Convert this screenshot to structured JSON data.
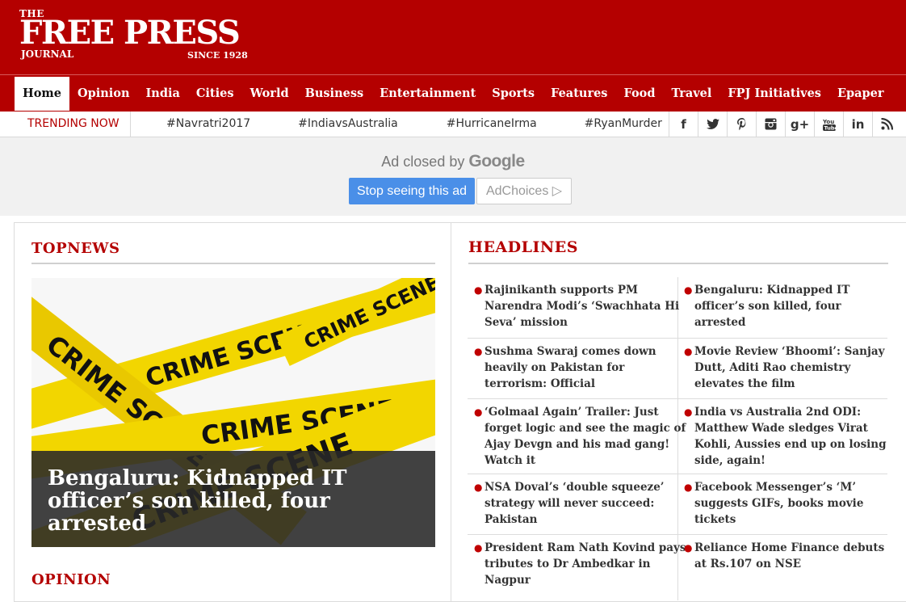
{
  "logo": {
    "the": "THE",
    "main": "FREE PRESS",
    "journal": "JOURNAL",
    "since": "SINCE 1928"
  },
  "nav": [
    "Home",
    "Opinion",
    "India",
    "Cities",
    "World",
    "Business",
    "Entertainment",
    "Sports",
    "Features",
    "Food",
    "Travel",
    "FPJ Initiatives",
    "Epaper"
  ],
  "trending": {
    "label": "TRENDING NOW",
    "tags": [
      "#Navratri2017",
      "#IndiavsAustralia",
      "#HurricaneIrma",
      "#RyanMurder"
    ]
  },
  "social_icons": [
    {
      "name": "facebook-icon",
      "glyph": "f"
    },
    {
      "name": "twitter-icon",
      "glyph": "🐦"
    },
    {
      "name": "pinterest-icon",
      "glyph": "P"
    },
    {
      "name": "instagram-icon",
      "glyph": "◙"
    },
    {
      "name": "googleplus-icon",
      "glyph": "g+"
    },
    {
      "name": "youtube-icon",
      "glyph": "▶"
    },
    {
      "name": "linkedin-icon",
      "glyph": "in"
    },
    {
      "name": "rss-icon",
      "glyph": "◉"
    }
  ],
  "ad": {
    "closed_prefix": "Ad closed by",
    "closed_brand": "Google",
    "stop_label": "Stop seeing this ad",
    "choices_label": "AdChoices ▷"
  },
  "topnews": {
    "heading": "TOPNEWS",
    "image_text": "CRIME SCENE",
    "caption": "Bengaluru: Kidnapped IT officer’s son killed, four arrested"
  },
  "opinion": {
    "heading": "OPINION"
  },
  "headlines": {
    "heading": "HEADLINES",
    "left": [
      "Rajinikanth supports PM Narendra Modi’s ‘Swachhata Hi Seva’ mission",
      "Sushma Swaraj comes down heavily on Pakistan for terrorism: Official",
      "‘Golmaal Again’ Trailer: Just forget logic and see the magic of Ajay Devgn and his mad gang! Watch it",
      "NSA Doval’s ‘double squeeze’ strategy will never succeed: Pakistan",
      "President Ram Nath Kovind pays tributes to Dr Ambedkar in Nagpur"
    ],
    "right": [
      "Bengaluru: Kidnapped IT officer’s son killed, four arrested",
      "Movie Review ‘Bhoomi’: Sanjay Dutt, Aditi Rao chemistry elevates the film",
      "India vs Australia 2nd ODI: Matthew Wade sledges Virat Kohli, Aussies end up on losing side, again!",
      "Facebook Messenger’s ‘M’ suggests GIFs, books movie tickets",
      "Reliance Home Finance debuts at Rs.107 on NSE"
    ]
  },
  "colors": {
    "brand_red": "#b40000",
    "ad_blue": "#4a8fe8",
    "tape_yellow": "#f2d600"
  }
}
